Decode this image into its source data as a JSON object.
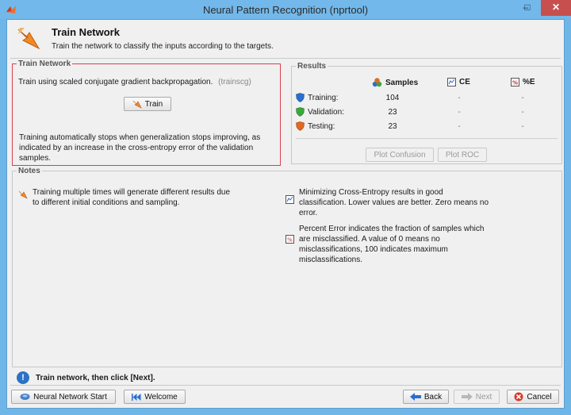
{
  "window": {
    "title": "Neural Pattern Recognition (nprtool)",
    "min_glyph": "–",
    "max_glyph": "□",
    "close_glyph": "✕"
  },
  "header": {
    "title": "Train Network",
    "subtitle": "Train the network to classify the inputs according to the targets."
  },
  "train_panel": {
    "label": "Train Network",
    "algorithm_text": "Train using scaled conjugate gradient backpropagation.",
    "algorithm_code": "(trainscg)",
    "train_button": "Train",
    "note": "Training automatically stops when generalization stops improving, as indicated by an increase in the cross-entropy error of the validation samples."
  },
  "results_panel": {
    "label": "Results",
    "columns": {
      "samples": "Samples",
      "ce": "CE",
      "pct_e": "%E"
    },
    "rows": [
      {
        "label": "Training:",
        "samples": "104",
        "ce": "-",
        "pct_e": "-",
        "color": "#2a6fd0"
      },
      {
        "label": "Validation:",
        "samples": "23",
        "ce": "-",
        "pct_e": "-",
        "color": "#3aa83a"
      },
      {
        "label": "Testing:",
        "samples": "23",
        "ce": "-",
        "pct_e": "-",
        "color": "#e06a1e"
      }
    ],
    "plot_confusion": "Plot Confusion",
    "plot_roc": "Plot ROC"
  },
  "notes_panel": {
    "label": "Notes",
    "left_note": "Training multiple times will generate different results due to different initial conditions and sampling.",
    "ce_note": "Minimizing Cross-Entropy results in good classification. Lower values are better. Zero means no error.",
    "pct_note": "Percent Error  indicates the fraction of samples which are misclassified. A value of 0 means no misclassifications, 100 indicates maximum misclassifications."
  },
  "status": {
    "text": "Train network, then click [Next].",
    "icon_glyph": "!"
  },
  "footer": {
    "nn_start": "Neural Network Start",
    "welcome": "Welcome",
    "back": "Back",
    "next": "Next",
    "cancel": "Cancel"
  },
  "colors": {
    "accent_orange": "#f08a24",
    "highlight_red": "#d84050",
    "info_blue": "#2a72c6",
    "cancel_red": "#d63a2a"
  }
}
